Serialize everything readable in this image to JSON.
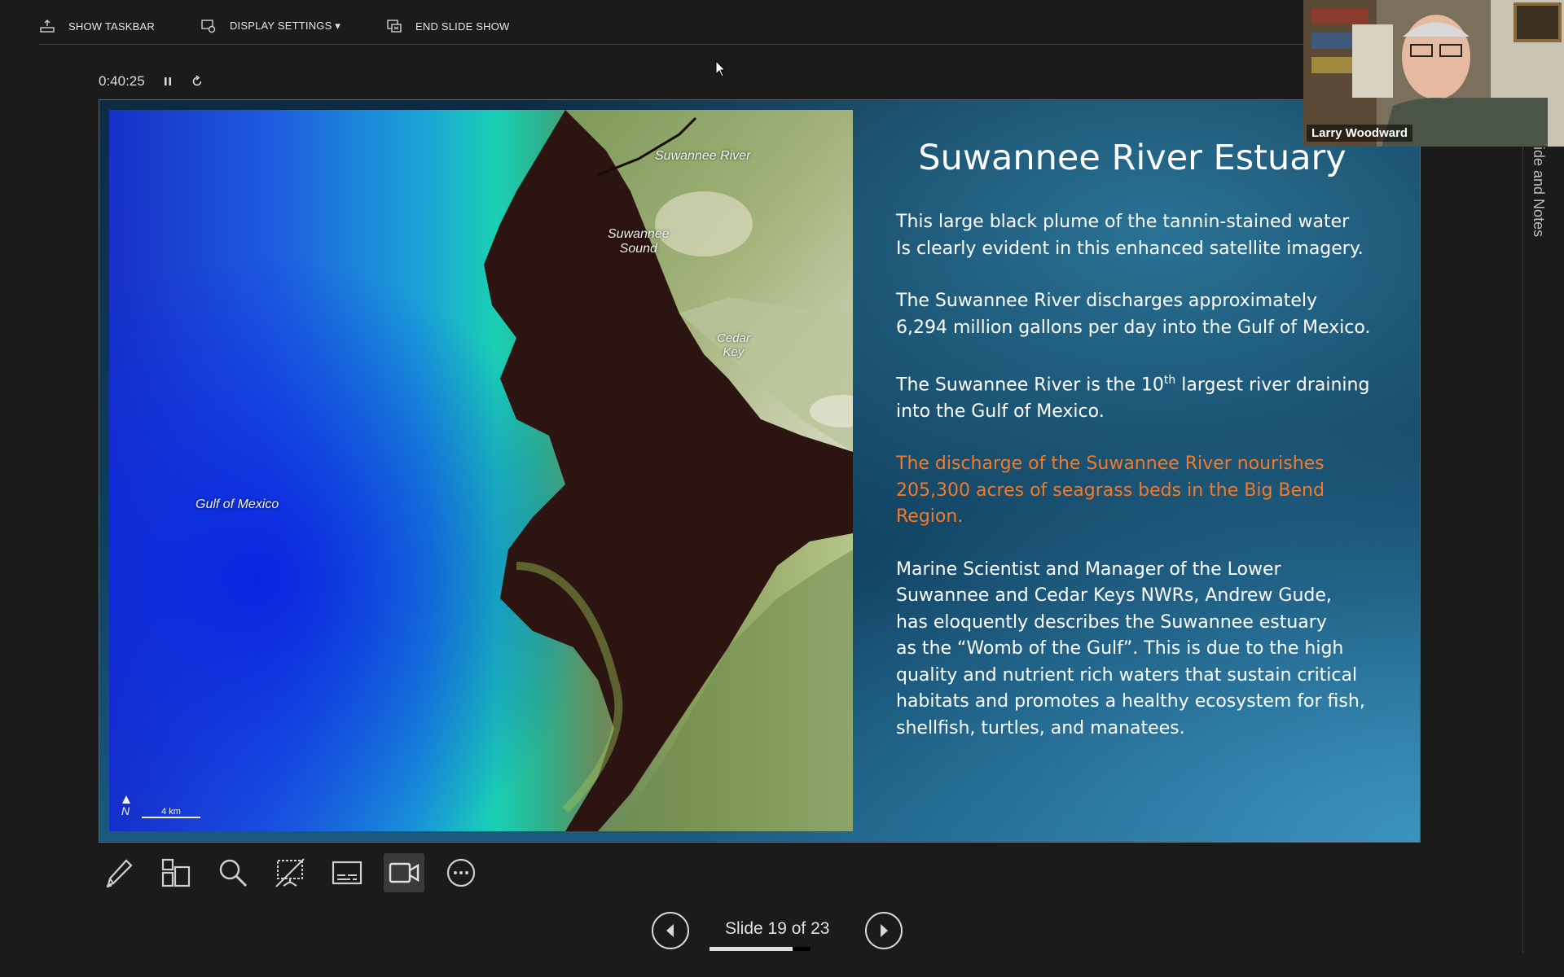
{
  "toolbar": {
    "show_taskbar": "SHOW TASKBAR",
    "display_settings": "DISPLAY SETTINGS ▾",
    "end_slide_show": "END SLIDE SHOW"
  },
  "timer": {
    "elapsed": "0:40:25"
  },
  "slide": {
    "title": "Suwannee River Estuary",
    "map_labels": {
      "river": "Suwannee River",
      "sound": "Suwannee\nSound",
      "key": "Cedar\nKey",
      "gulf": "Gulf of Mexico",
      "scale": "4 km",
      "north": "N"
    },
    "paragraphs": {
      "p1": "This large black plume of the tannin-stained water\nIs clearly evident in this enhanced satellite imagery.",
      "p2": "The Suwannee River discharges approximately\n6,294 million gallons per day into the Gulf of Mexico.",
      "p3_a": "The Suwannee River is the 10",
      "p3_sup": "th",
      "p3_b": " largest river draining\ninto the Gulf of Mexico.",
      "p4": "The discharge of the Suwannee River nourishes\n205,300 acres of seagrass beds in the Big Bend\nRegion.",
      "p5": "Marine Scientist and Manager of the Lower\nSuwannee and Cedar Keys NWRs, Andrew Gude,\nhas eloquently describes the Suwannee estuary\nas the “Womb of the Gulf”.  This is due to the high\nquality and nutrient rich waters that sustain critical\nhabitats and promotes a healthy ecosystem for fish,\nshellfish, turtles, and manatees."
    },
    "colors": {
      "highlight": "#f47a28"
    }
  },
  "presenter": {
    "name": "Larry Woodward"
  },
  "notes_tab": "ide and Notes",
  "navigation": {
    "slide_label": "Slide 19 of 23",
    "progress": 0.826
  },
  "tools": [
    "pen-icon",
    "see-all-slides-icon",
    "zoom-icon",
    "black-screen-icon",
    "subtitles-icon",
    "camera-icon",
    "more-options-icon"
  ]
}
